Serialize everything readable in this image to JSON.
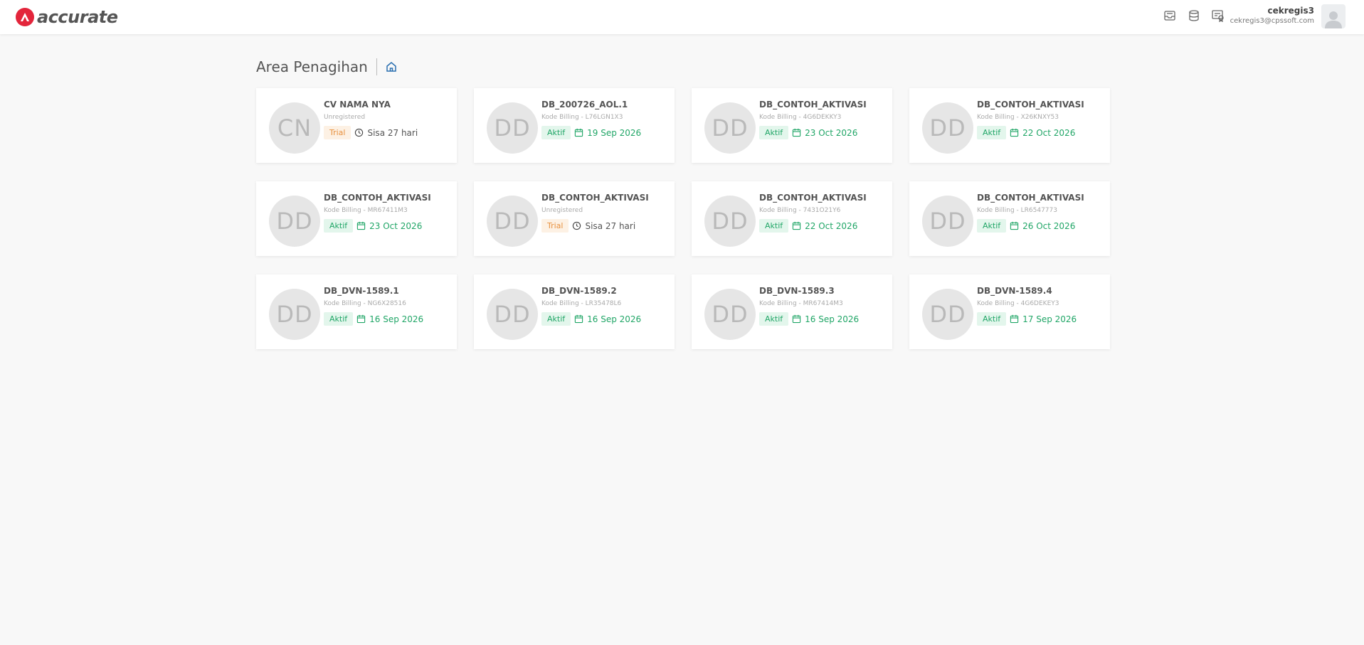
{
  "app": {
    "logo_text": "accurate",
    "brand_color": "#e3253b"
  },
  "user": {
    "name": "cekregis3",
    "email": "cekregis3@cpssoft.com"
  },
  "header_icons": [
    "inbox-icon",
    "database-icon",
    "certificate-icon"
  ],
  "page": {
    "title": "Area Penagihan",
    "home_icon": "home-icon"
  },
  "cards": [
    {
      "initials": "CN",
      "name": "CV NAMA NYA",
      "subtitle": "Unregistered",
      "status": "Trial",
      "detail": "Sisa 27 hari"
    },
    {
      "initials": "DD",
      "name": "DB_200726_AOL.1",
      "subtitle": "Kode Billing - L76LGN1X3",
      "status": "Aktif",
      "detail": "19 Sep 2026"
    },
    {
      "initials": "DD",
      "name": "DB_CONTOH_AKTIVASI",
      "subtitle": "Kode Billing - 4G6DEKKY3",
      "status": "Aktif",
      "detail": "23 Oct 2026"
    },
    {
      "initials": "DD",
      "name": "DB_CONTOH_AKTIVASI",
      "subtitle": "Kode Billing - X26KNXY53",
      "status": "Aktif",
      "detail": "22 Oct 2026"
    },
    {
      "initials": "DD",
      "name": "DB_CONTOH_AKTIVASI",
      "subtitle": "Kode Billing - MR67411M3",
      "status": "Aktif",
      "detail": "23 Oct 2026"
    },
    {
      "initials": "DD",
      "name": "DB_CONTOH_AKTIVASI",
      "subtitle": "Unregistered",
      "status": "Trial",
      "detail": "Sisa 27 hari"
    },
    {
      "initials": "DD",
      "name": "DB_CONTOH_AKTIVASI",
      "subtitle": "Kode Billing - 7431O21Y6",
      "status": "Aktif",
      "detail": "22 Oct 2026"
    },
    {
      "initials": "DD",
      "name": "DB_CONTOH_AKTIVASI",
      "subtitle": "Kode Billing - LR6547773",
      "status": "Aktif",
      "detail": "26 Oct 2026"
    },
    {
      "initials": "DD",
      "name": "DB_DVN-1589.1",
      "subtitle": "Kode Billing - NG6X28516",
      "status": "Aktif",
      "detail": "16 Sep 2026"
    },
    {
      "initials": "DD",
      "name": "DB_DVN-1589.2",
      "subtitle": "Kode Billing - LR35478L6",
      "status": "Aktif",
      "detail": "16 Sep 2026"
    },
    {
      "initials": "DD",
      "name": "DB_DVN-1589.3",
      "subtitle": "Kode Billing - MR67414M3",
      "status": "Aktif",
      "detail": "16 Sep 2026"
    },
    {
      "initials": "DD",
      "name": "DB_DVN-1589.4",
      "subtitle": "Kode Billing - 4G6DEKEY3",
      "status": "Aktif",
      "detail": "17 Sep 2026"
    }
  ],
  "colors": {
    "aktif": "#21a667",
    "trial": "#e89240"
  }
}
